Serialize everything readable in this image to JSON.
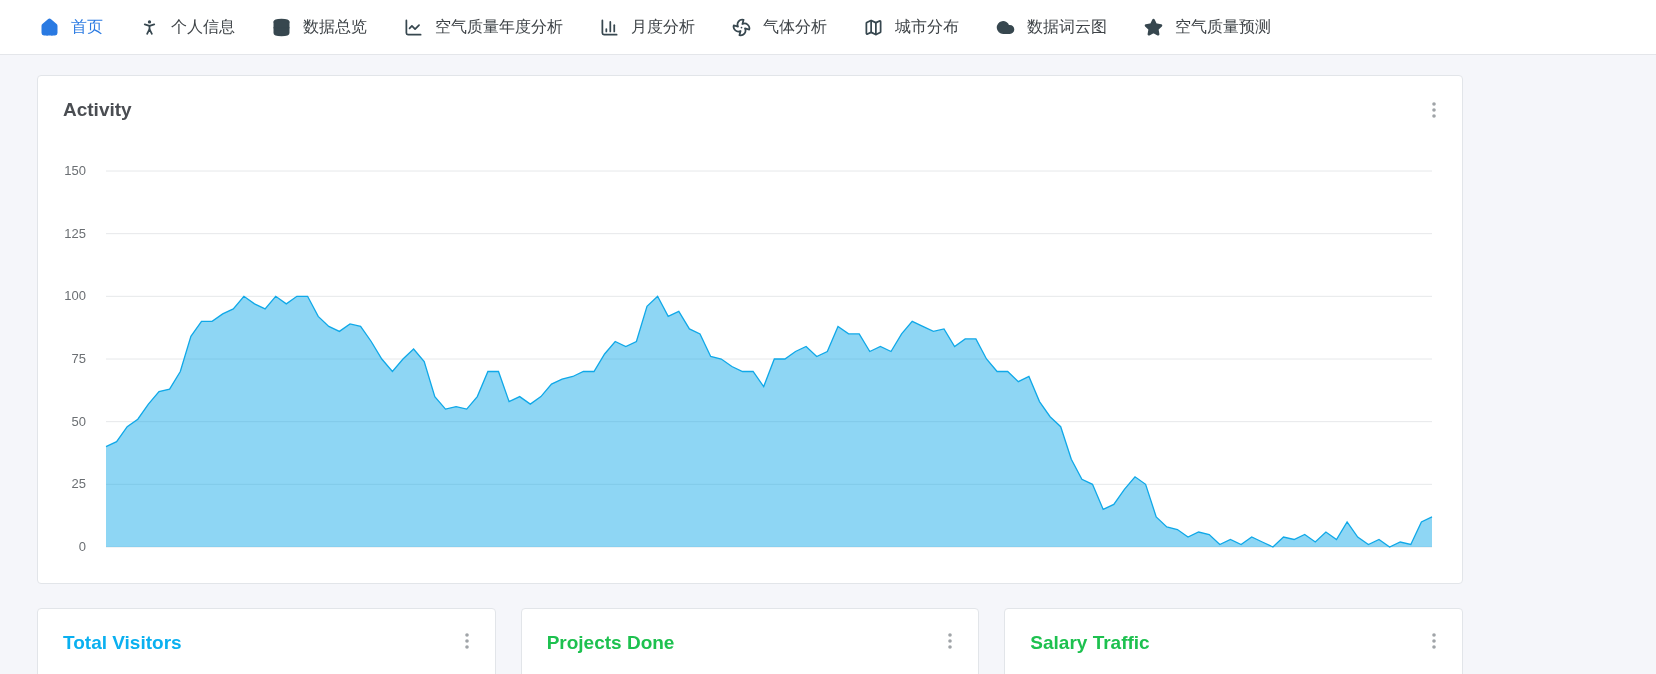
{
  "nav": [
    {
      "label": "首页",
      "selected": true
    },
    {
      "label": "个人信息",
      "selected": false
    },
    {
      "label": "数据总览",
      "selected": false
    },
    {
      "label": "空气质量年度分析",
      "selected": false
    },
    {
      "label": "月度分析",
      "selected": false
    },
    {
      "label": "气体分析",
      "selected": false
    },
    {
      "label": "城市分布",
      "selected": false
    },
    {
      "label": "数据词云图",
      "selected": false
    },
    {
      "label": "空气质量预测",
      "selected": false
    }
  ],
  "activity": {
    "title": "Activity",
    "chart_data": {
      "type": "area",
      "grid": true,
      "ylim": [
        0,
        150
      ],
      "yticks": [
        0,
        25,
        50,
        75,
        100,
        125,
        150
      ],
      "series": [
        {
          "color": "#0fa8e8",
          "values": [
            40,
            42,
            48,
            51,
            57,
            62,
            63,
            70,
            84,
            90,
            90,
            93,
            95,
            100,
            97,
            95,
            100,
            97,
            100,
            100,
            92,
            88,
            86,
            89,
            88,
            82,
            75,
            70,
            75,
            79,
            74,
            60,
            55,
            56,
            55,
            60,
            70,
            70,
            58,
            60,
            57,
            60,
            65,
            67,
            68,
            70,
            70,
            77,
            82,
            80,
            82,
            96,
            100,
            92,
            94,
            87,
            85,
            76,
            75,
            72,
            70,
            70,
            64,
            75,
            75,
            78,
            80,
            76,
            78,
            88,
            85,
            85,
            78,
            80,
            78,
            85,
            90,
            88,
            86,
            87,
            80,
            83,
            83,
            75,
            70,
            70,
            66,
            68,
            58,
            52,
            48,
            35,
            27,
            25,
            15,
            17,
            23,
            28,
            25,
            12,
            8,
            7,
            4,
            6,
            5,
            1,
            3,
            1,
            4,
            2,
            0,
            4,
            3,
            5,
            2,
            6,
            3,
            10,
            4,
            1,
            3,
            0,
            2,
            1,
            10,
            12
          ]
        }
      ]
    }
  },
  "cards": [
    {
      "title": "Total Visitors",
      "color": "#0ab0f0"
    },
    {
      "title": "Projects Done",
      "color": "#1dc14f"
    },
    {
      "title": "Salary Traffic",
      "color": "#1dc14f"
    }
  ]
}
